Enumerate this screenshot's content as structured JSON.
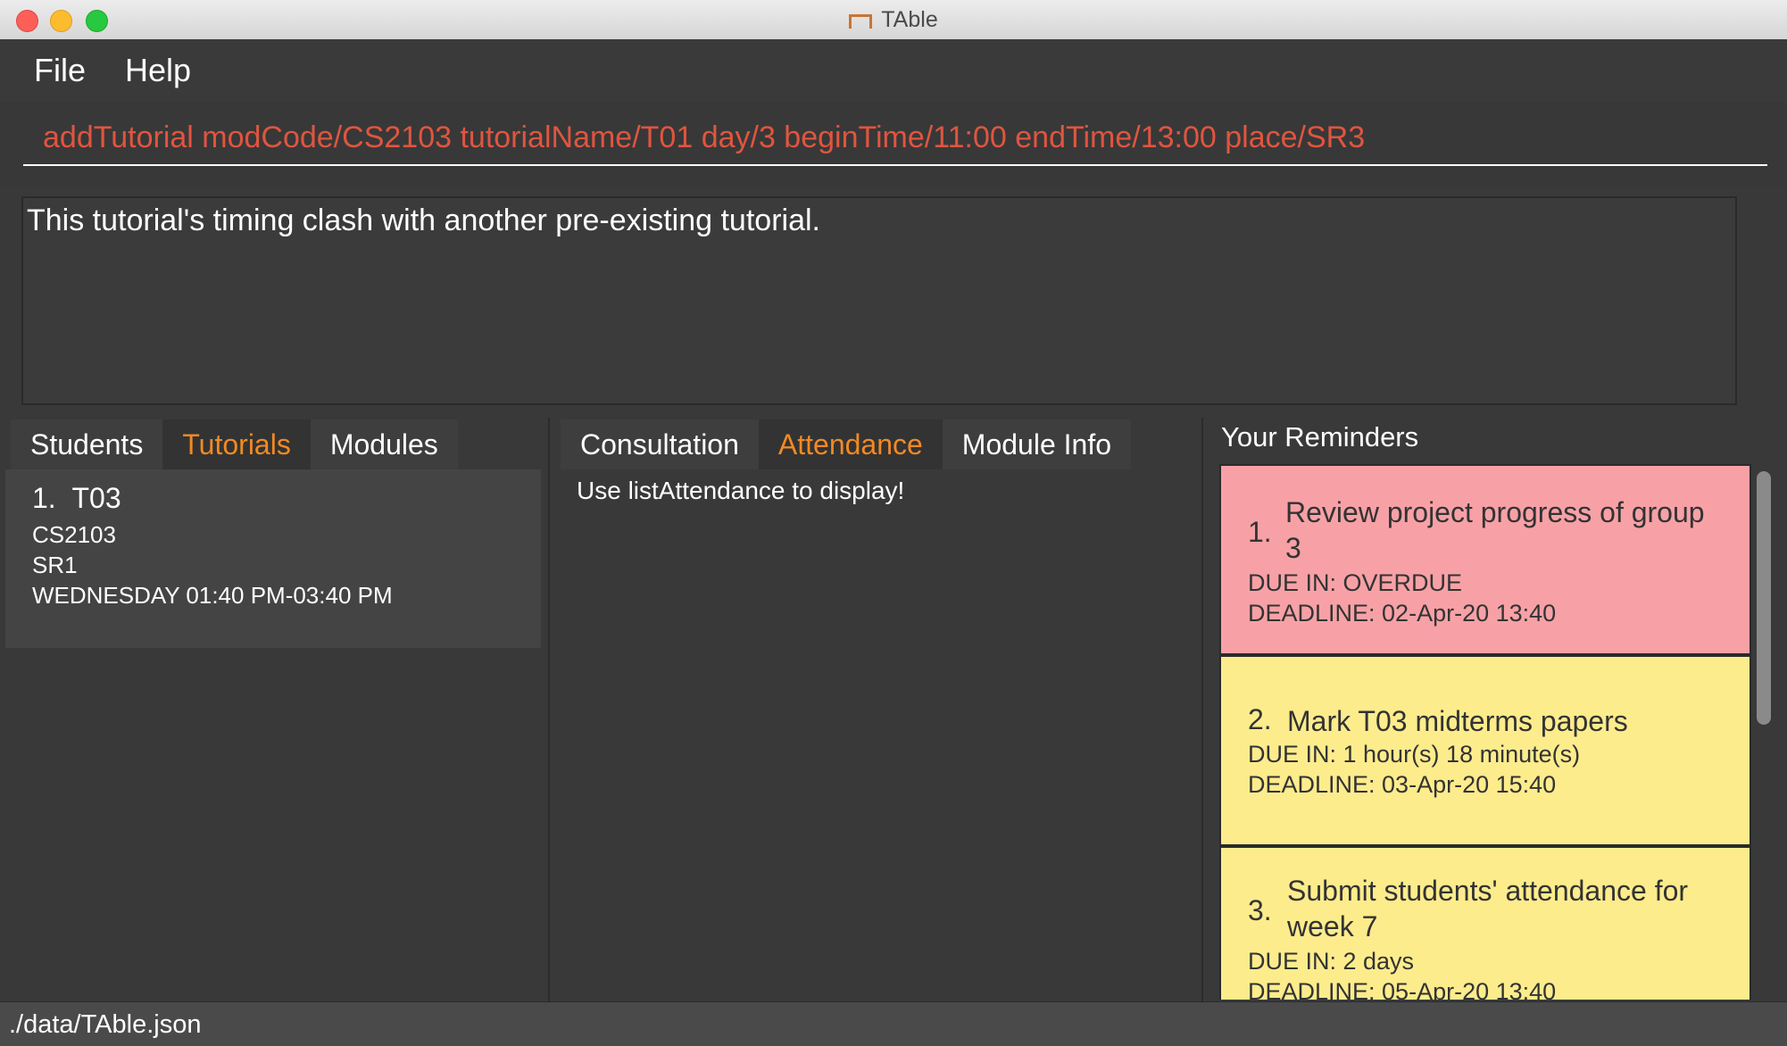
{
  "window": {
    "title": "TAble"
  },
  "menu": {
    "file": "File",
    "help": "Help"
  },
  "command": {
    "value": "addTutorial modCode/CS2103 tutorialName/T01 day/3 beginTime/11:00 endTime/13:00 place/SR3",
    "text_color": "#e0553f"
  },
  "result": {
    "message": "This tutorial's timing clash with another pre-existing tutorial."
  },
  "left_tabs": {
    "items": [
      "Students",
      "Tutorials",
      "Modules"
    ],
    "selected": "Tutorials"
  },
  "tutorial_list": [
    {
      "index": "1.",
      "name": "T03",
      "module": "CS2103",
      "place": "SR1",
      "time": "WEDNESDAY 01:40 PM-03:40 PM"
    }
  ],
  "mid_tabs": {
    "items": [
      "Consultation",
      "Attendance",
      "Module Info"
    ],
    "selected": "Attendance"
  },
  "attendance": {
    "message": "Use listAttendance to display!"
  },
  "reminders": {
    "header": "Your Reminders",
    "items": [
      {
        "index": "1.",
        "title_line1": "Review project progress of group",
        "title_line2": "3",
        "due": "DUE IN: OVERDUE",
        "deadline": "DEADLINE: 02-Apr-20 13:40",
        "color": "#f7a1a6"
      },
      {
        "index": "2.",
        "title_line1": "Mark T03 midterms papers",
        "title_line2": "",
        "due": "DUE IN: 1 hour(s) 18 minute(s)",
        "deadline": "DEADLINE: 03-Apr-20 15:40",
        "color": "#fdec8c"
      },
      {
        "index": "3.",
        "title_line1": "Submit students' attendance for",
        "title_line2": "week 7",
        "due": "DUE IN: 2 days",
        "deadline": "DEADLINE: 05-Apr-20 13:40",
        "color": "#fdec8c"
      }
    ]
  },
  "status": {
    "path": "./data/TAble.json"
  },
  "colors": {
    "accent": "#f08a24",
    "background": "#393939"
  }
}
